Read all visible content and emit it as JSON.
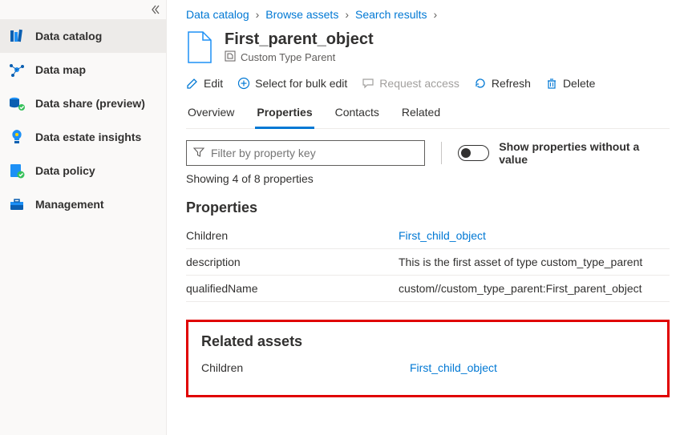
{
  "sidebar": {
    "items": [
      {
        "label": "Data catalog"
      },
      {
        "label": "Data map"
      },
      {
        "label": "Data share (preview)"
      },
      {
        "label": "Data estate insights"
      },
      {
        "label": "Data policy"
      },
      {
        "label": "Management"
      }
    ]
  },
  "breadcrumbs": {
    "items": [
      "Data catalog",
      "Browse assets",
      "Search results"
    ]
  },
  "asset": {
    "title": "First_parent_object",
    "subtype": "Custom Type Parent"
  },
  "toolbar": {
    "edit": "Edit",
    "select_bulk": "Select for bulk edit",
    "request_access": "Request access",
    "refresh": "Refresh",
    "delete": "Delete"
  },
  "tabs": {
    "overview": "Overview",
    "properties": "Properties",
    "contacts": "Contacts",
    "related": "Related"
  },
  "filter": {
    "placeholder": "Filter by property key",
    "toggle_label": "Show properties without a value",
    "showing": "Showing 4 of 8 properties"
  },
  "sections": {
    "properties_heading": "Properties",
    "related_heading": "Related assets"
  },
  "properties": [
    {
      "key": "Children",
      "value": "First_child_object",
      "is_link": true
    },
    {
      "key": "description",
      "value": "This is the first asset of type custom_type_parent",
      "is_link": false
    },
    {
      "key": "qualifiedName",
      "value": "custom//custom_type_parent:First_parent_object",
      "is_link": false
    }
  ],
  "related": [
    {
      "key": "Children",
      "value": "First_child_object"
    }
  ]
}
